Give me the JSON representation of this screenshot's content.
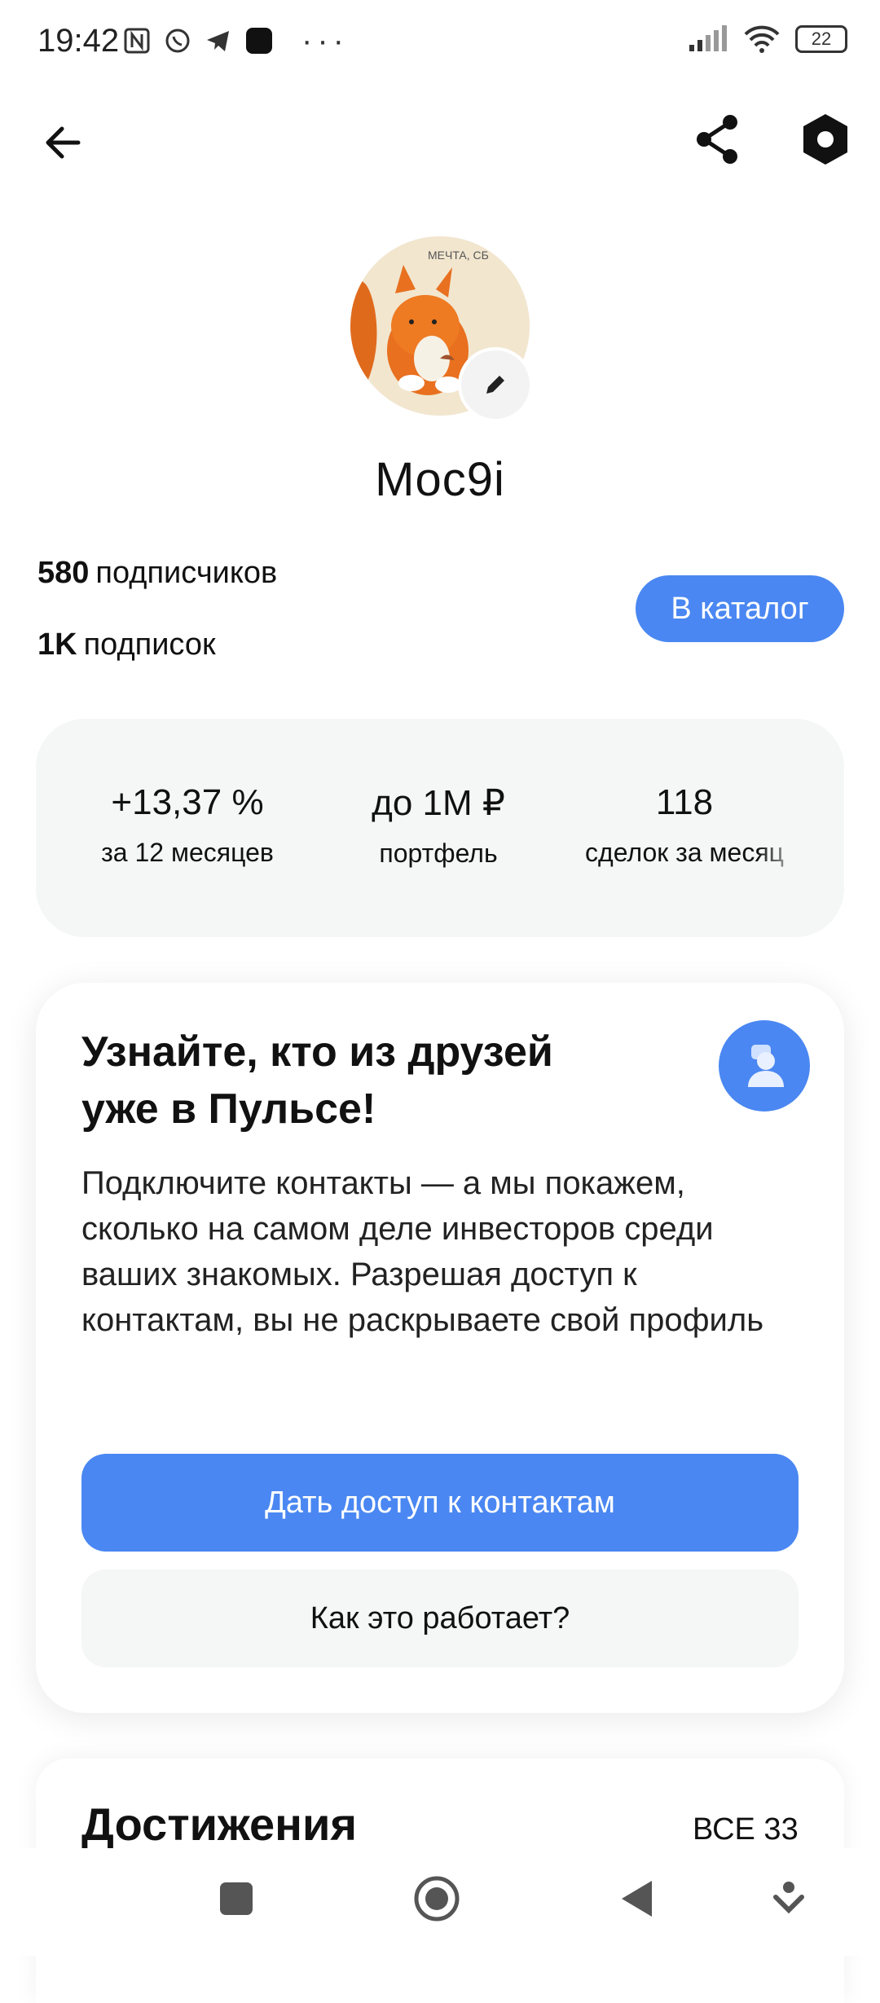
{
  "status_bar": {
    "time": "19:42",
    "battery": "22",
    "more": "···"
  },
  "header": {
    "back_icon": "arrow-left-icon",
    "share_icon": "share-icon",
    "settings_icon": "hexagon-settings-icon"
  },
  "profile": {
    "username": "Moc9i",
    "avatar": "squirrel-avatar",
    "followers_count": "580",
    "followers_label": "подписчиков",
    "following_count": "1K",
    "following_label": "подписок",
    "catalog_button": "В каталог"
  },
  "stats": [
    {
      "value": "+13,37 %",
      "label": "за 12 месяцев"
    },
    {
      "value": "до 1М ₽",
      "label": "портфель"
    },
    {
      "value": "118",
      "label": "сделок за месяц"
    }
  ],
  "friends_card": {
    "title": "Узнайте, кто из друзей уже в Пульсе!",
    "text": "Подключите контакты — а мы покажем, сколько на самом деле инвесторов среди ваших знакомых. Разрешая доступ к контактам, вы не раскрываете свой профиль",
    "primary_button": "Дать доступ к контактам",
    "secondary_button": "Как это работает?"
  },
  "achievements": {
    "title": "Достижения",
    "all_link": "ВСЕ 33"
  },
  "colors": {
    "accent": "#4a87f2",
    "card_bg": "#f5f6f6"
  }
}
